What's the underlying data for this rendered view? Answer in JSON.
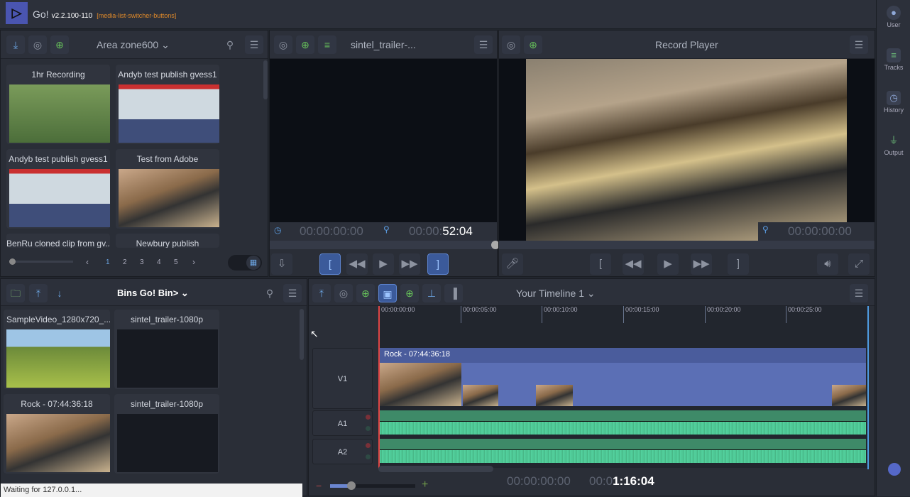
{
  "app": {
    "name": "Go!",
    "version": "v2.2.100-110",
    "tag": "[media-list-switcher-buttons]"
  },
  "right_sidebar": [
    {
      "label": "User",
      "icon": "user-icon"
    },
    {
      "label": "Tracks",
      "icon": "tracks-icon"
    },
    {
      "label": "History",
      "icon": "history-icon"
    },
    {
      "label": "Output",
      "icon": "output-icon"
    }
  ],
  "area_panel": {
    "title": "Area zone600",
    "clips": [
      "1hr Recording",
      "Andyb test publish gvess1",
      "Andyb test publish gvess1",
      "Test from Adobe",
      "BenRu cloned clip from gv...",
      "Newbury publish"
    ],
    "pages": [
      "1",
      "2",
      "3",
      "4",
      "5"
    ],
    "current_page": "1"
  },
  "source_player": {
    "title": "sintel_trailer-...",
    "timecode_in": "00:00:00:00",
    "duration_prefix": "00:00:",
    "duration": "52:04"
  },
  "record_player": {
    "title": "Record Player",
    "timecode": "00:00:00:00"
  },
  "bins_panel": {
    "title": "Bins Go! Bin>",
    "clips": [
      "SampleVideo_1280x720_...",
      "sintel_trailer-1080p",
      "Rock - 07:44:36:18",
      "sintel_trailer-1080p"
    ]
  },
  "timeline": {
    "title": "Your Timeline 1",
    "ruler": [
      "00:00:00:00",
      "00:00:05:00",
      "00:00:10:00",
      "00:00:15:00",
      "00:00:20:00",
      "00:00:25:00"
    ],
    "tracks": [
      "V1",
      "A1",
      "A2"
    ],
    "clip_label": "Rock - 07:44:36:18",
    "timecode_in": "00:00:00:00",
    "duration_prefix": "00:0",
    "duration": "1:16:04",
    "zoom_level": 0.25
  },
  "status": "Waiting for 127.0.0.1..."
}
